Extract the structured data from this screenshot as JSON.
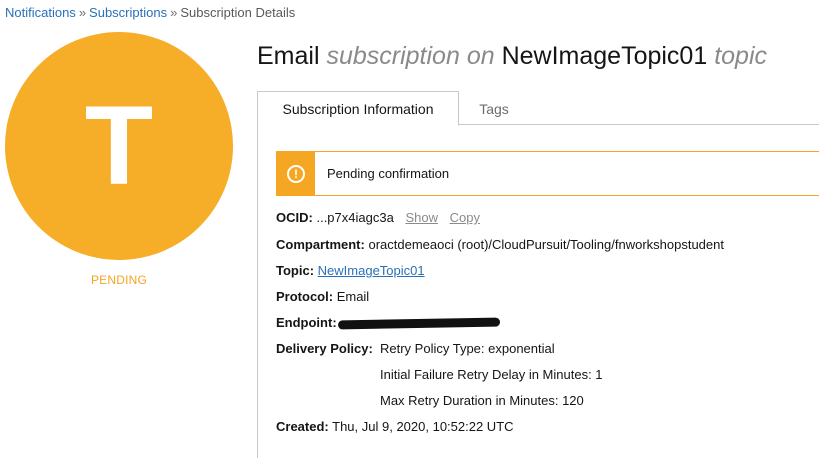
{
  "breadcrumb": {
    "items": [
      "Notifications",
      "Subscriptions"
    ],
    "separator": "»",
    "current": "Subscription Details"
  },
  "avatar": {
    "letter": "T",
    "color": "#f6ad28",
    "status": "PENDING",
    "status_color": "#f5a623"
  },
  "title": {
    "protocol": "Email",
    "mid": "subscription on",
    "topic_name": "NewImageTopic01",
    "suffix": "topic"
  },
  "tabs": [
    {
      "label": "Subscription Information",
      "active": true
    },
    {
      "label": "Tags",
      "active": false
    }
  ],
  "alert": {
    "icon": "alert-exclamation-icon",
    "text": "Pending confirmation",
    "color": "#f5a623"
  },
  "details": {
    "ocid": {
      "label": "OCID:",
      "value": "...p7x4iagc3a",
      "show_label": "Show",
      "copy_label": "Copy"
    },
    "compartment": {
      "label": "Compartment:",
      "value": "oractdemeaoci (root)/CloudPursuit/Tooling/fnworkshopstudent"
    },
    "topic": {
      "label": "Topic:",
      "value": "NewImageTopic01"
    },
    "protocol": {
      "label": "Protocol:",
      "value": "Email"
    },
    "endpoint": {
      "label": "Endpoint:"
    },
    "delivery_policy": {
      "label": "Delivery Policy:",
      "values": [
        "Retry Policy Type: exponential",
        "Initial Failure Retry Delay in Minutes: 1",
        "Max Retry Duration in Minutes: 120"
      ]
    },
    "created": {
      "label": "Created:",
      "value": "Thu, Jul 9, 2020, 10:52:22 UTC"
    }
  }
}
